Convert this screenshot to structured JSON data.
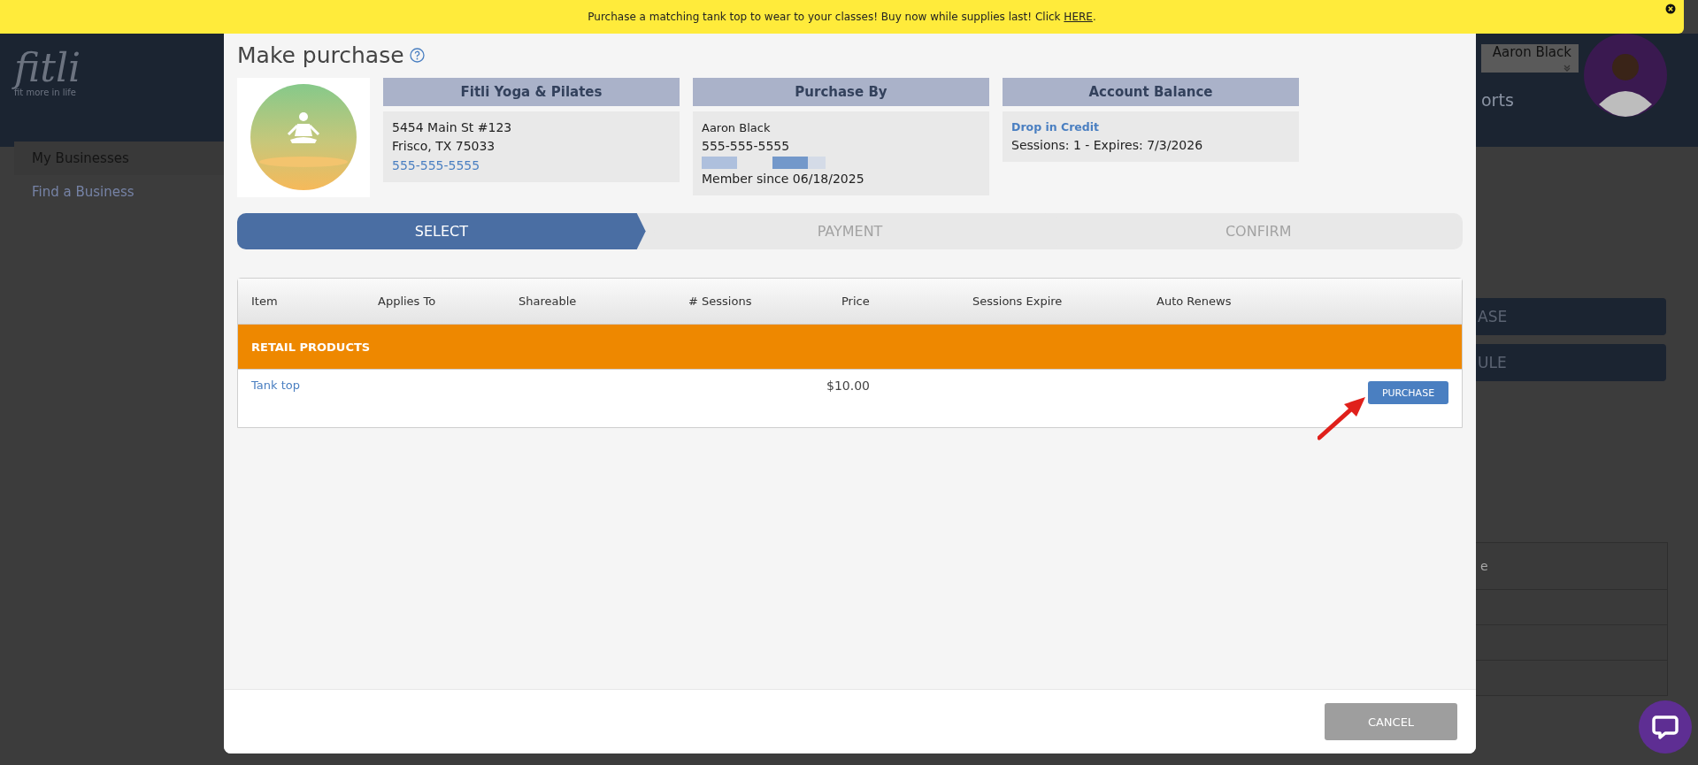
{
  "banner": {
    "text": "Purchase a matching tank top to wear to your classes! Buy now while supplies last! Click",
    "link": "HERE",
    "link_end": "."
  },
  "header": {
    "logo": "fitli",
    "tagline": "fit more in life",
    "user_name": "Aaron Black",
    "nav_fragment": "orts"
  },
  "sidebar": {
    "items": [
      {
        "label": "My Businesses",
        "selected": true
      },
      {
        "label": "Find a Business",
        "selected": false
      }
    ]
  },
  "background": {
    "buttons": [
      "ASE",
      "ULE"
    ],
    "table_heading_fragment": "e"
  },
  "modal": {
    "title": "Make purchase",
    "business": {
      "title": "Fitli Yoga & Pilates",
      "lines": [
        "5454 Main St #123",
        "Frisco, TX 75033"
      ],
      "phone": "555-555-5555"
    },
    "purchase_by": {
      "title": "Purchase By",
      "name": "Aaron Black",
      "phone": "555-555-5555",
      "member_since": "Member since 06/18/2025"
    },
    "account_balance": {
      "title": "Account Balance",
      "credit_name": "Drop in Credit",
      "sessions": "Sessions: 1 -  Expires: 7/3/2026"
    },
    "steps": [
      {
        "label": "SELECT",
        "selected": true
      },
      {
        "label": "PAYMENT",
        "selected": false
      },
      {
        "label": "CONFIRM",
        "selected": false
      }
    ],
    "table": {
      "columns": [
        "Item",
        "Applies To",
        "Shareable",
        "# Sessions",
        "Price",
        "Sessions Expire",
        "Auto Renews"
      ],
      "groups": [
        {
          "name": "RETAIL PRODUCTS",
          "rows": [
            {
              "item": "Tank top",
              "price": "$10.00",
              "action": "PURCHASE"
            }
          ]
        }
      ]
    },
    "cancel": "CANCEL"
  }
}
